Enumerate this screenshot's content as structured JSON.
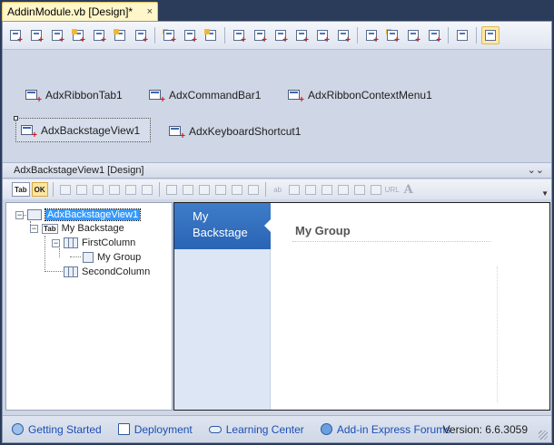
{
  "document_tab": {
    "title": "AddinModule.vb [Design]*",
    "close_glyph": "×"
  },
  "toolbar": {
    "buttons": [
      {
        "icon": "ribbon-tab-icon"
      },
      {
        "icon": "command-bar-icon"
      },
      {
        "icon": "context-menu-icon"
      },
      {
        "icon": "backstage-icon"
      },
      {
        "icon": "keyboard-shortcut-icon"
      },
      {
        "icon": "task-pane-icon"
      },
      {
        "icon": "event-icon"
      },
      {
        "icon": "shape-icon"
      },
      {
        "icon": "outlook-bar-icon"
      },
      {
        "icon": "new-component-icon"
      },
      {
        "icon": "form-icon"
      },
      {
        "icon": "grid-icon"
      },
      {
        "icon": "explorer-bar-icon"
      },
      {
        "icon": "inspector-bar-icon"
      },
      {
        "icon": "region-icon"
      },
      {
        "icon": "table-icon"
      },
      {
        "icon": "excel-icon"
      },
      {
        "icon": "outlook-icon"
      },
      {
        "icon": "powerpoint-icon"
      },
      {
        "icon": "word-icon"
      },
      {
        "icon": "dropdown-options-icon"
      },
      {
        "icon": "properties-icon"
      }
    ]
  },
  "components": [
    {
      "label": "AdxRibbonTab1",
      "icon": "ribbon-tab-icon"
    },
    {
      "label": "AdxCommandBar1",
      "icon": "command-bar-icon"
    },
    {
      "label": "AdxRibbonContextMenu1",
      "icon": "context-menu-icon"
    },
    {
      "label": "AdxBackstageView1",
      "icon": "backstage-view-icon"
    },
    {
      "label": "AdxKeyboardShortcut1",
      "icon": "keyboard-shortcut-icon"
    }
  ],
  "designer": {
    "header": "AdxBackstageView1 [Design]",
    "collapse_glyph": "⌄⌄",
    "toolbar": {
      "tab_label": "Tab",
      "ok_label": "OK",
      "ab_label": "ab",
      "url_label": "URL",
      "font_label": "A"
    }
  },
  "tree": {
    "nodes": [
      {
        "label": "AdxBackstageView1",
        "level": 0,
        "selected": true
      },
      {
        "label": "My Backstage",
        "level": 1,
        "selected": false
      },
      {
        "label": "FirstColumn",
        "level": 2,
        "selected": false
      },
      {
        "label": "My Group",
        "level": 3,
        "selected": false
      },
      {
        "label": "SecondColumn",
        "level": 2,
        "selected": false
      }
    ]
  },
  "preview": {
    "tab_label_1": "My",
    "tab_label_2": "Backstage",
    "group_title": "My Group"
  },
  "statusbar": {
    "links": [
      {
        "label": "Getting Started",
        "icon": "help-circle-icon"
      },
      {
        "label": "Deployment",
        "icon": "book-icon"
      },
      {
        "label": "Learning Center",
        "icon": "chain-link-icon"
      },
      {
        "label": "Add-in Express Forums",
        "icon": "people-icon"
      }
    ],
    "version": "Version: 6.6.3059"
  }
}
